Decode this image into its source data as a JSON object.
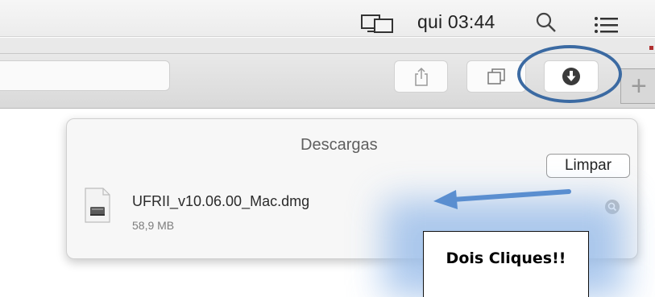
{
  "menubar": {
    "clock": "qui 03:44",
    "icons": [
      "screen-mirroring-icon",
      "spotlight-search-icon",
      "notification-center-icon"
    ]
  },
  "toolbar": {
    "buttons": [
      "share-icon",
      "tabs-overview-icon",
      "downloads-icon",
      "new-tab-icon"
    ],
    "new_tab_symbol": "+"
  },
  "downloads": {
    "title": "Descargas",
    "clear_label": "Limpar",
    "items": [
      {
        "name": "UFRII_v10.06.00_Mac.dmg",
        "size": "58,9 MB",
        "icon": "disk-image-icon"
      }
    ]
  },
  "annotation": {
    "callout_text": "Dois Cliques!!",
    "arrow_color": "#5a8ed0",
    "ellipse_color": "#3b6aa2"
  }
}
